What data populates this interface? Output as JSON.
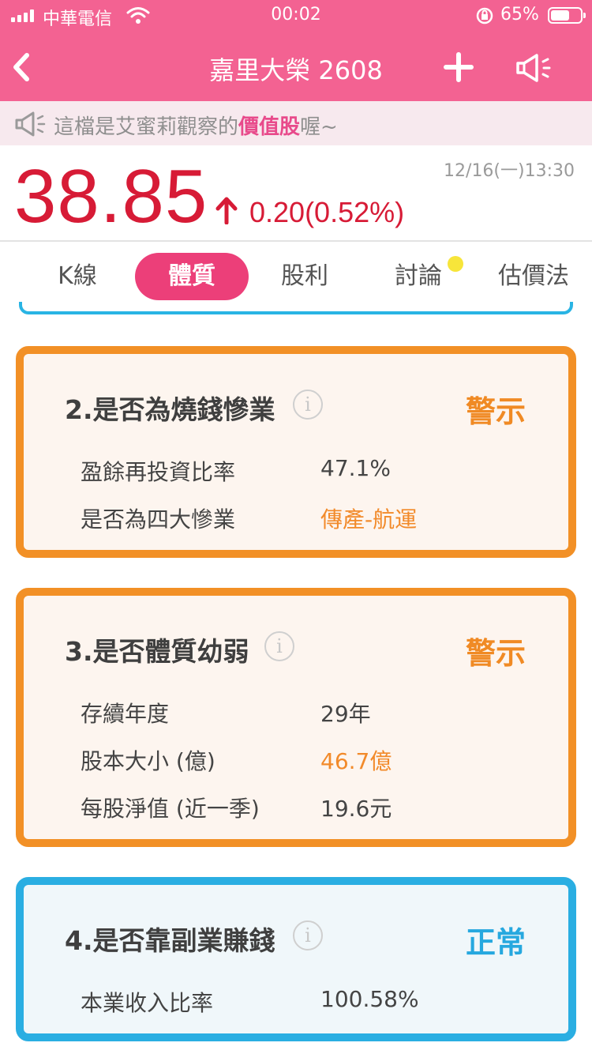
{
  "status_bar": {
    "carrier": "中華電信",
    "time": "00:02",
    "battery": "65%",
    "battery_level": 0.65
  },
  "nav": {
    "title": "嘉里大榮 2608"
  },
  "notice": {
    "prefix": "這檔是艾蜜莉觀察的",
    "highlight": "價值股",
    "suffix": "喔~"
  },
  "quote": {
    "price": "38.85",
    "change": "0.20(0.52%)",
    "timestamp": "12/16(一)13:30"
  },
  "tabs": [
    {
      "label": "K線"
    },
    {
      "label": "體質"
    },
    {
      "label": "股利"
    },
    {
      "label": "討論"
    },
    {
      "label": "估價法"
    }
  ],
  "cards": [
    {
      "title": "2.是否為燒錢慘業",
      "status": "警示",
      "rows": [
        {
          "label": "盈餘再投資比率",
          "value": "47.1%"
        },
        {
          "label": "是否為四大慘業",
          "value": "傳產-航運"
        }
      ]
    },
    {
      "title": "3.是否體質幼弱",
      "status": "警示",
      "rows": [
        {
          "label": "存續年度",
          "value": "29年"
        },
        {
          "label": "股本大小 (億)",
          "value": "46.7億"
        },
        {
          "label": "每股淨值 (近一季)",
          "value": "19.6元"
        }
      ]
    },
    {
      "title": "4.是否靠副業賺錢",
      "status": "正常",
      "rows": [
        {
          "label": "本業收入比率",
          "value": "100.58%"
        }
      ]
    }
  ],
  "info_glyph": "i",
  "colors": {
    "brand_pink": "#f36292",
    "price_red": "#d71b36",
    "warn_orange": "#f29026",
    "ok_blue": "#2aaee2"
  },
  "icons": [
    "signal-icon",
    "wifi-icon",
    "rotation-lock-icon",
    "battery-icon",
    "back-chevron-icon",
    "plus-icon",
    "megaphone-icon",
    "up-arrow-icon",
    "info-icon"
  ]
}
